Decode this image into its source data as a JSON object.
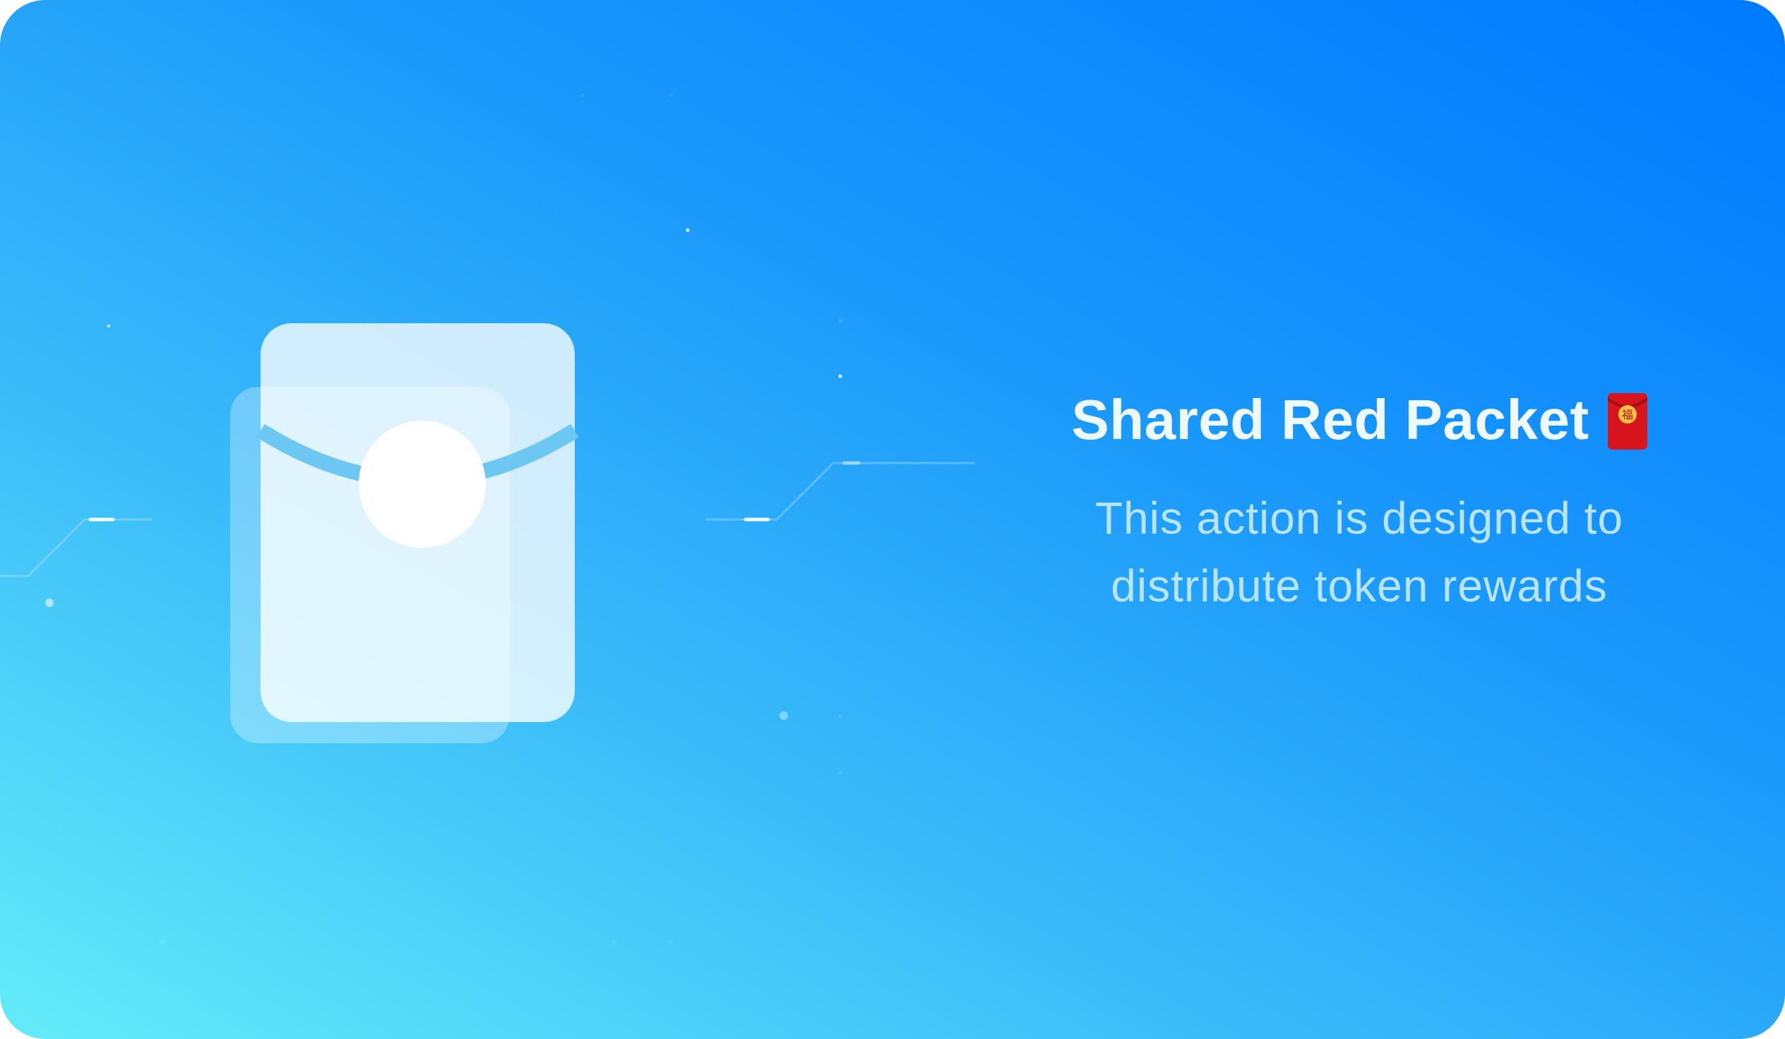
{
  "title": "Shared Red Packet",
  "title_icon": "red-envelope-icon",
  "description": {
    "line1": "This action is designed to",
    "line2": "distribute token rewards"
  },
  "illustration_icon": "envelope-icon",
  "colors": {
    "gradient_top": "#007aff",
    "gradient_bottom": "#64ecf9",
    "packet_red": "#d8141c",
    "packet_gold": "#f4c542"
  }
}
